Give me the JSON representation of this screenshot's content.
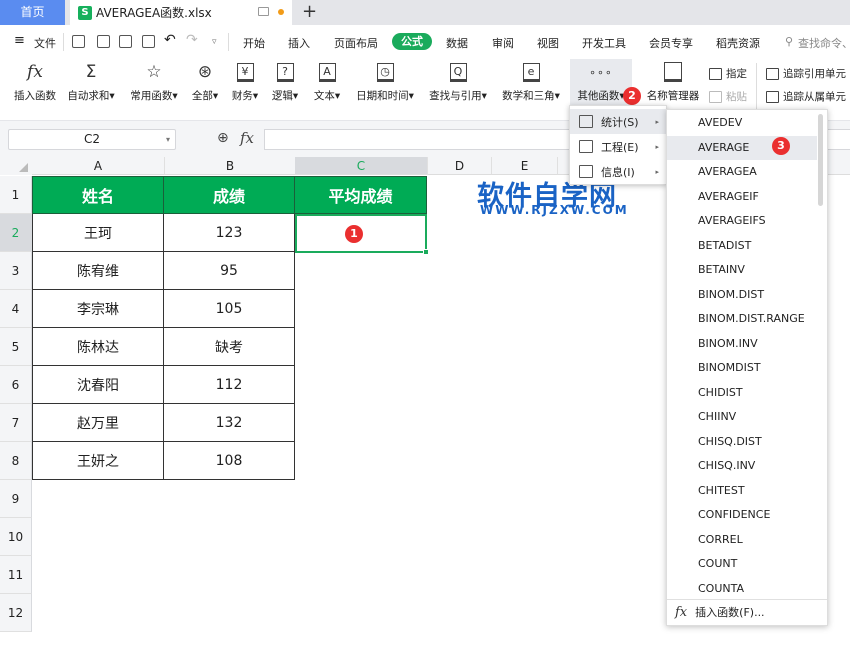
{
  "tabs": {
    "home": "首页",
    "file": "AVERAGEA函数.xlsx",
    "file_icon": "S",
    "add": "+"
  },
  "menubar": {
    "file_menu": "文件",
    "tabs": [
      "开始",
      "插入",
      "页面布局",
      "公式",
      "数据",
      "审阅",
      "视图",
      "开发工具",
      "会员专享",
      "稻壳资源"
    ],
    "active_tab": "公式",
    "search_placeholder": "查找命令、"
  },
  "ribbon": {
    "buttons": [
      {
        "label": "插入函数",
        "icon": "fx"
      },
      {
        "label": "自动求和▾",
        "icon": "Σ"
      },
      {
        "label": "常用函数▾",
        "icon": "☆"
      },
      {
        "label": "全部▾",
        "icon": "⊛"
      },
      {
        "label": "财务▾",
        "icon": "¥"
      },
      {
        "label": "逻辑▾",
        "icon": "?"
      },
      {
        "label": "文本▾",
        "icon": "A"
      },
      {
        "label": "日期和时间▾",
        "icon": "◷"
      },
      {
        "label": "查找与引用▾",
        "icon": "Q"
      },
      {
        "label": "数学和三角▾",
        "icon": "e"
      },
      {
        "label": "其他函数▾",
        "icon": "∘∘∘"
      },
      {
        "label": "名称管理器",
        "icon": "▭"
      }
    ],
    "small": {
      "specify": "指定",
      "paste": "粘贴",
      "trace_precedents": "追踪引用单元",
      "trace_dependents": "追踪从属单元"
    }
  },
  "formula_bar": {
    "name_box": "C2",
    "fx": "fx",
    "value": ""
  },
  "sheet": {
    "columns": [
      "A",
      "B",
      "C",
      "D",
      "E"
    ],
    "selected_column": "C",
    "rows": [
      "1",
      "2",
      "3",
      "4",
      "5",
      "6",
      "7",
      "8",
      "9",
      "10",
      "11",
      "12"
    ],
    "selected_row": "2",
    "header": [
      "姓名",
      "成绩",
      "平均成绩"
    ],
    "data": [
      [
        "王珂",
        "123",
        ""
      ],
      [
        "陈宥维",
        "95",
        ""
      ],
      [
        "李宗琳",
        "105",
        ""
      ],
      [
        "陈林达",
        "缺考",
        ""
      ],
      [
        "沈春阳",
        "112",
        ""
      ],
      [
        "赵万里",
        "132",
        ""
      ],
      [
        "王妍之",
        "108",
        ""
      ]
    ],
    "active_cell": "C2"
  },
  "watermark": {
    "title": "软件自学网",
    "url": "WWW.RJZXW.COM"
  },
  "submenu": {
    "items": [
      {
        "label": "统计(S)",
        "active": true
      },
      {
        "label": "工程(E)",
        "active": false
      },
      {
        "label": "信息(I)",
        "active": false
      }
    ]
  },
  "function_menu": {
    "items": [
      "AVEDEV",
      "AVERAGE",
      "AVERAGEA",
      "AVERAGEIF",
      "AVERAGEIFS",
      "BETADIST",
      "BETAINV",
      "BINOM.DIST",
      "BINOM.DIST.RANGE",
      "BINOM.INV",
      "BINOMDIST",
      "CHIDIST",
      "CHIINV",
      "CHISQ.DIST",
      "CHISQ.INV",
      "CHITEST",
      "CONFIDENCE",
      "CORREL",
      "COUNT",
      "COUNTA"
    ],
    "highlighted": "AVERAGE",
    "insert_function": "插入函数(F)..."
  },
  "badges": {
    "step1": "1",
    "step2": "2",
    "step3": "3"
  },
  "colors": {
    "accent": "#1aab5c",
    "header_fill": "#00ab55",
    "badge": "#ea2f2f",
    "home_tab": "#5a8cf0",
    "watermark": "#1a63c5"
  }
}
